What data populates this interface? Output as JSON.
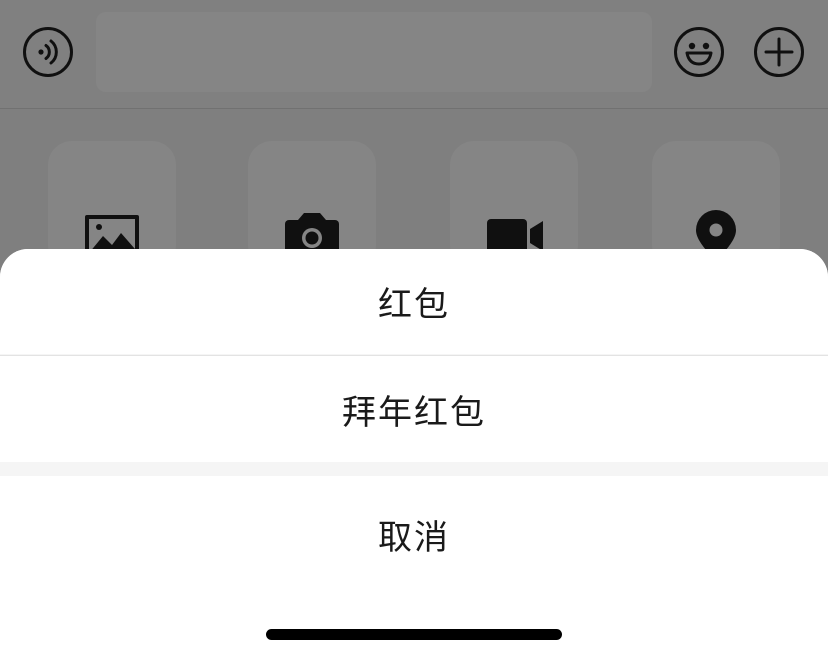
{
  "input_bar": {
    "voice_icon": "voice-icon",
    "text_value": "",
    "emoji_icon": "emoji-icon",
    "more_icon": "plus-icon"
  },
  "panel": {
    "tiles": [
      {
        "icon": "image-icon"
      },
      {
        "icon": "camera-icon"
      },
      {
        "icon": "video-camera-icon"
      },
      {
        "icon": "location-pin-icon"
      }
    ]
  },
  "action_sheet": {
    "options": [
      {
        "label": "红包"
      },
      {
        "label": "拜年红包"
      }
    ],
    "cancel_label": "取消"
  },
  "colors": {
    "overlay": "#000000",
    "sheet_background": "#ffffff",
    "sheet_separator": "#f5f5f5",
    "text": "#1a1a1a"
  }
}
